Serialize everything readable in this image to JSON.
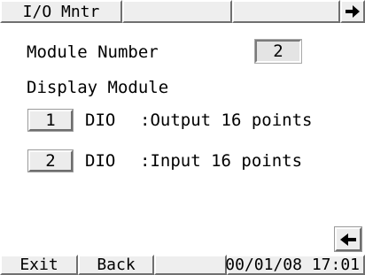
{
  "header": {
    "title_tab": "I/O Mntr",
    "next_icon": "arrow-right-icon"
  },
  "module_number": {
    "label": "Module Number",
    "value": "2"
  },
  "display_module": {
    "label": "Display Module"
  },
  "modules": [
    {
      "index": "1",
      "type": "DIO",
      "desc": ":Output 16 points"
    },
    {
      "index": "2",
      "type": "DIO",
      "desc": ":Input 16 points"
    }
  ],
  "back_icon": "arrow-left-icon",
  "footer": {
    "exit_label": "Exit",
    "back_label": "Back",
    "datetime": "00/01/08 17:01"
  }
}
